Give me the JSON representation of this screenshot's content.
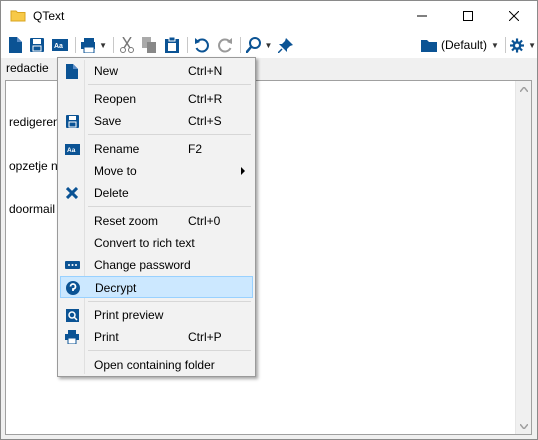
{
  "window": {
    "title": "QText",
    "icon": "folder-note-icon",
    "controls": [
      "minimize-icon",
      "maximize-icon",
      "close-icon"
    ]
  },
  "toolbar": {
    "profile_label": "(Default)",
    "buttons": [
      "new-icon",
      "save-icon",
      "rename-icon",
      "print-icon",
      "cut-icon",
      "copy-icon",
      "paste-icon",
      "undo-icon",
      "redo-icon",
      "find-icon",
      "pin-icon",
      "settings-icon"
    ]
  },
  "tab": {
    "label": "redactie"
  },
  "editor": {
    "lines": [
      "redigeren",
      "opzetje n",
      "doormail"
    ]
  },
  "context_menu": {
    "items": [
      {
        "label": "New",
        "shortcut": "Ctrl+N",
        "icon": "new-document-icon"
      },
      {
        "label": "Reopen",
        "shortcut": "Ctrl+R",
        "icon": ""
      },
      {
        "label": "Save",
        "shortcut": "Ctrl+S",
        "icon": "save-icon"
      },
      {
        "label": "Rename",
        "shortcut": "F2",
        "icon": "rename-icon"
      },
      {
        "label": "Move to",
        "shortcut": "",
        "icon": ""
      },
      {
        "label": "Delete",
        "shortcut": "",
        "icon": "delete-icon"
      },
      {
        "label": "Reset zoom",
        "shortcut": "Ctrl+0",
        "icon": ""
      },
      {
        "label": "Convert to rich text",
        "shortcut": "",
        "icon": ""
      },
      {
        "label": "Change password",
        "shortcut": "",
        "icon": "password-icon"
      },
      {
        "label": "Decrypt",
        "shortcut": "",
        "icon": "decrypt-icon",
        "highlighted": true
      },
      {
        "label": "Print preview",
        "shortcut": "",
        "icon": "print-preview-icon"
      },
      {
        "label": "Print",
        "shortcut": "Ctrl+P",
        "icon": "print-icon"
      },
      {
        "label": "Open containing folder",
        "shortcut": "",
        "icon": ""
      }
    ]
  },
  "colors": {
    "accent": "#0b5394",
    "highlight_bg": "#cce8ff",
    "highlight_border": "#99d1ff"
  }
}
